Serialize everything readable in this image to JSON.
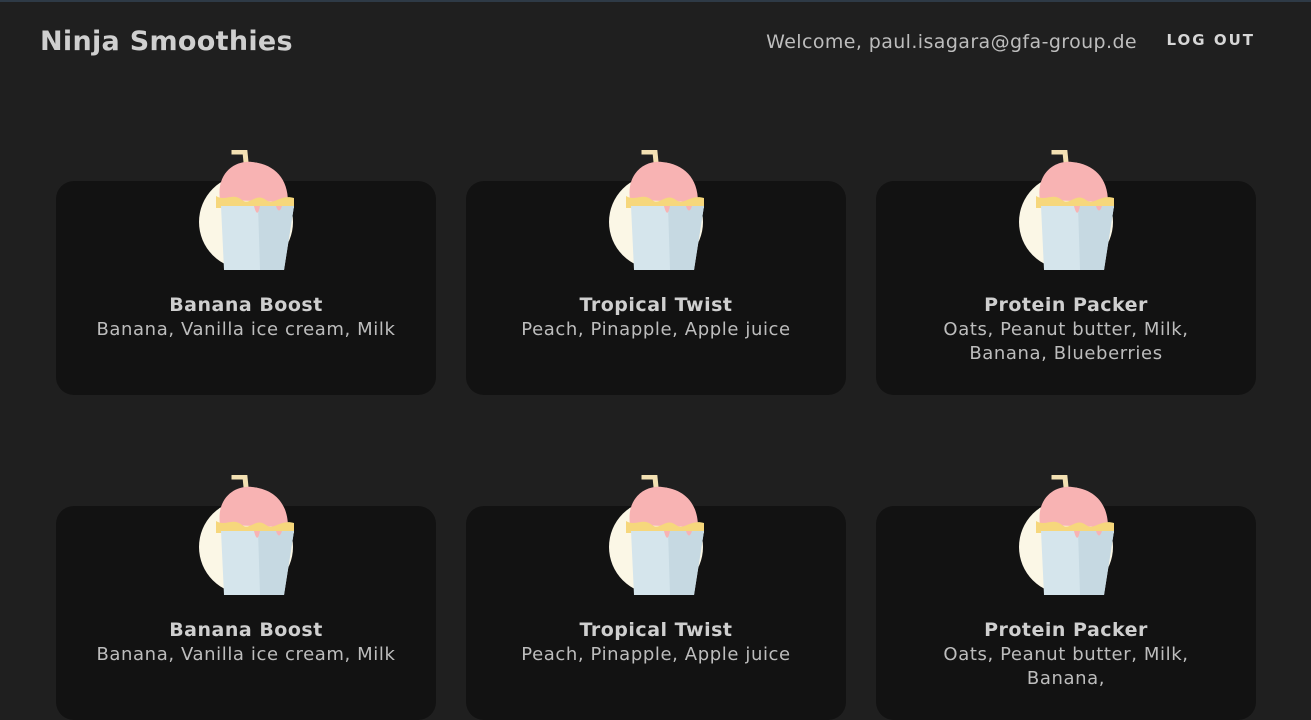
{
  "navbar": {
    "brand": "Ninja Smoothies",
    "welcome": "Welcome, paul.isagara@gfa-group.de",
    "logout_label": "LOG OUT"
  },
  "colors": {
    "background": "#1f1f1f",
    "card": "#121212",
    "circle": "#fbf7e6",
    "cup": "#d5e5ec",
    "cup_shade": "#c6d9e2",
    "scoop": "#f8b3b3",
    "cream": "#f6d77c",
    "straw": "#f3e0b2"
  },
  "smoothies": [
    {
      "title": "Banana Boost",
      "ingredients": "Banana, Vanilla ice cream, Milk",
      "icon": "smoothie-cup-icon"
    },
    {
      "title": "Tropical Twist",
      "ingredients": "Peach, Pinapple, Apple juice",
      "icon": "smoothie-cup-icon"
    },
    {
      "title": "Protein Packer",
      "ingredients": "Oats, Peanut butter, Milk, Banana, Blueberries",
      "icon": "smoothie-cup-icon"
    },
    {
      "title": "Banana Boost",
      "ingredients": "Banana, Vanilla ice cream, Milk",
      "icon": "smoothie-cup-icon"
    },
    {
      "title": "Tropical Twist",
      "ingredients": "Peach, Pinapple, Apple juice",
      "icon": "smoothie-cup-icon"
    },
    {
      "title": "Protein Packer",
      "ingredients": "Oats, Peanut butter, Milk, Banana,",
      "icon": "smoothie-cup-icon"
    }
  ]
}
